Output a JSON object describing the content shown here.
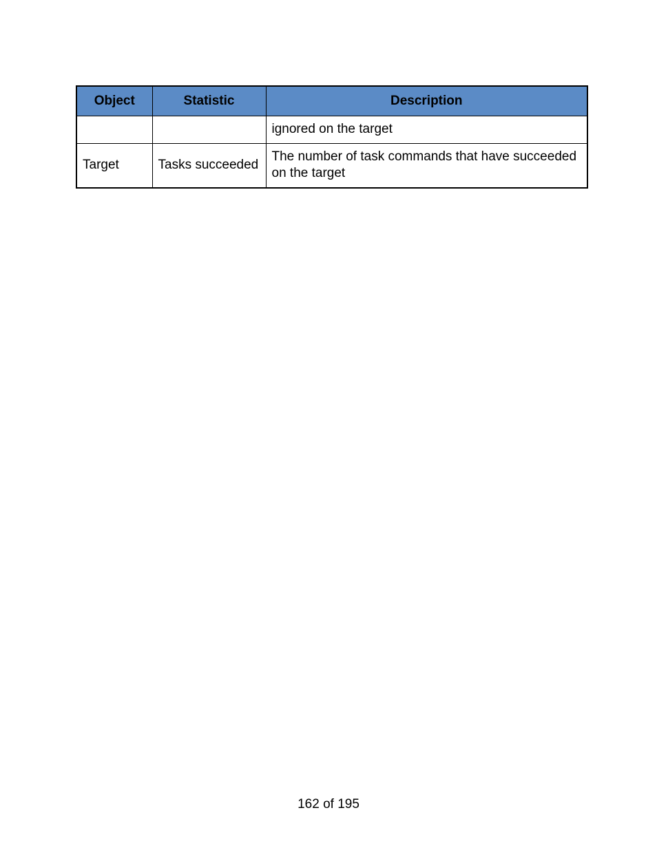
{
  "table": {
    "headers": {
      "object": "Object",
      "statistic": "Statistic",
      "description": "Description"
    },
    "rows": [
      {
        "object": "",
        "statistic": "",
        "description": "ignored on the target"
      },
      {
        "object": "Target",
        "statistic": "Tasks succeeded",
        "description": "The number of task commands that have succeeded on the target"
      }
    ]
  },
  "footer": {
    "page_label": "162 of 195"
  }
}
